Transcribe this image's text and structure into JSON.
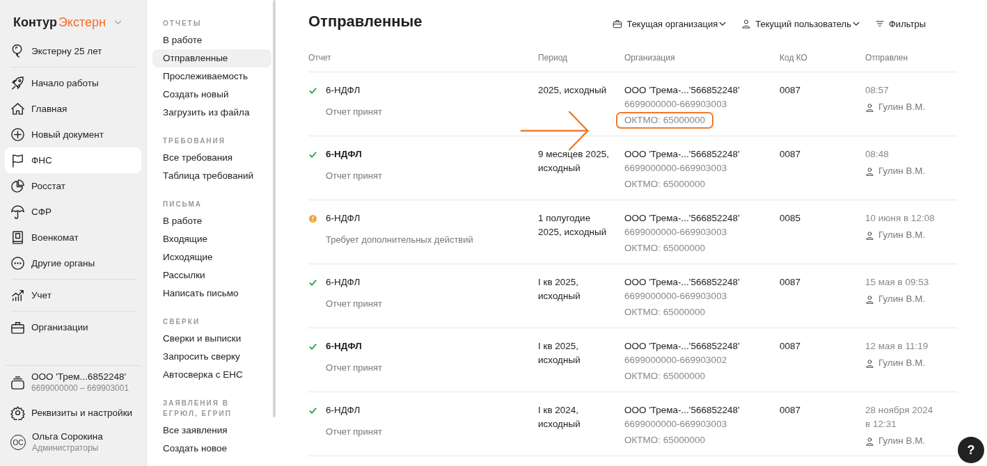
{
  "brand": {
    "name": "Контур",
    "product": "Экстерн"
  },
  "nav": {
    "groups": [
      [
        {
          "label": "Экстерну 25 лет",
          "selected": false
        }
      ],
      [
        {
          "label": "Начало работы",
          "selected": false
        },
        {
          "label": "Главная",
          "selected": false
        },
        {
          "label": "Новый документ",
          "selected": false
        },
        {
          "label": "ФНС",
          "selected": true
        },
        {
          "label": "Росстат",
          "selected": false
        },
        {
          "label": "СФР",
          "selected": false
        },
        {
          "label": "Военкомат",
          "selected": false
        },
        {
          "label": "Другие органы",
          "selected": false
        }
      ],
      [
        {
          "label": "Учет",
          "selected": false
        }
      ],
      [
        {
          "label": "Организации",
          "selected": false
        }
      ]
    ]
  },
  "footer": {
    "org": {
      "name": "ООО 'Трем...6852248'",
      "range": "6699000000 – 669903001"
    },
    "settings": "Реквизиты и настройки",
    "user": {
      "initials": "ОС",
      "name": "Ольга Сорокина",
      "role": "Администраторы"
    }
  },
  "subnav": [
    {
      "title": "ОТЧЕТЫ",
      "items": [
        {
          "label": "В работе",
          "selected": false
        },
        {
          "label": "Отправленные",
          "selected": true
        },
        {
          "label": "Прослеживаемость",
          "selected": false
        },
        {
          "label": "Создать новый",
          "selected": false
        },
        {
          "label": "Загрузить из файла",
          "selected": false
        }
      ]
    },
    {
      "title": "ТРЕБОВАНИЯ",
      "items": [
        {
          "label": "Все требования",
          "selected": false
        },
        {
          "label": "Таблица требований",
          "selected": false
        }
      ]
    },
    {
      "title": "ПИСЬМА",
      "items": [
        {
          "label": "В работе",
          "selected": false
        },
        {
          "label": "Входящие",
          "selected": false
        },
        {
          "label": "Исходящие",
          "selected": false
        },
        {
          "label": "Рассылки",
          "selected": false
        },
        {
          "label": "Написать письмо",
          "selected": false
        }
      ]
    },
    {
      "title": "СВЕРКИ",
      "items": [
        {
          "label": "Сверки и выписки",
          "selected": false
        },
        {
          "label": "Запросить сверку",
          "selected": false
        },
        {
          "label": "Автосверка с ЕНС",
          "selected": false
        }
      ]
    },
    {
      "title": "ЗАЯВЛЕНИЯ В ЕГРЮЛ, ЕГРИП",
      "items": [
        {
          "label": "Все заявления",
          "selected": false
        },
        {
          "label": "Создать новое",
          "selected": false
        }
      ]
    }
  ],
  "page": {
    "title": "Отправленные",
    "toolbar": [
      {
        "label": "Текущая организация",
        "dropdown": true
      },
      {
        "label": "Текущий пользователь",
        "dropdown": true
      },
      {
        "label": "Фильтры",
        "dropdown": false
      }
    ],
    "table": {
      "columns": [
        "Отчет",
        "Период",
        "Организация",
        "Код КО",
        "Отправлен"
      ],
      "rows": [
        {
          "kind": "accepted",
          "title": "6-НДФЛ",
          "bold": false,
          "status_text": "Отчет принят",
          "period": "2025, исходный",
          "org": {
            "name": "ООО 'Трема-...'566852248'",
            "range": "6699000000-669903003",
            "oktmo": "ОКТМО: 65000000",
            "highlighted": true
          },
          "code": "0087",
          "sent": "08:57",
          "user": "Гулин В.М."
        },
        {
          "kind": "accepted",
          "title": "6-НДФЛ",
          "bold": true,
          "status_text": "Отчет принят",
          "period": "9 месяцев 2025, исходный",
          "org": {
            "name": "ООО 'Трема-...'566852248'",
            "range": "6699000000-669903003",
            "oktmo": "ОКТМО: 65000000",
            "highlighted": false
          },
          "code": "0087",
          "sent": "08:48",
          "user": "Гулин В.М."
        },
        {
          "kind": "warning",
          "title": "6-НДФЛ",
          "bold": false,
          "status_text": "Требует дополнительных действий",
          "period": "1 полугодие 2025, исходный",
          "org": {
            "name": "ООО 'Трема-...'566852248'",
            "range": "6699000000-669903003",
            "oktmo": "ОКТМО: 65000000",
            "highlighted": false
          },
          "code": "0085",
          "sent": "10 июня в 12:08",
          "user": "Гулин В.М."
        },
        {
          "kind": "accepted",
          "title": "6-НДФЛ",
          "bold": false,
          "status_text": "Отчет принят",
          "period": "I кв 2025, исходный",
          "org": {
            "name": "ООО 'Трема-...'566852248'",
            "range": "6699000000-669903003",
            "oktmo": "ОКТМО: 65000000",
            "highlighted": false
          },
          "code": "0087",
          "sent": "15 мая в 09:53",
          "user": "Гулин В.М."
        },
        {
          "kind": "accepted",
          "title": "6-НДФЛ",
          "bold": true,
          "status_text": "Отчет принят",
          "period": "I кв 2025, исходный",
          "org": {
            "name": "ООО 'Трема-...'566852248'",
            "range": "6699000000-669903002",
            "oktmo": "ОКТМО: 65000000",
            "highlighted": false
          },
          "code": "0087",
          "sent": "12 мая в 11:19",
          "user": "Гулин В.М."
        },
        {
          "kind": "accepted",
          "title": "6-НДФЛ",
          "bold": false,
          "status_text": "Отчет принят",
          "period": "I кв 2024, исходный",
          "org": {
            "name": "ООО 'Трема-...'566852248'",
            "range": "6699000000-669903003",
            "oktmo": "ОКТМО: 65000000",
            "highlighted": false
          },
          "code": "0087",
          "sent": "28 ноября 2024 в 12:31",
          "user": "Гулин В.М."
        }
      ]
    }
  },
  "help": "?"
}
